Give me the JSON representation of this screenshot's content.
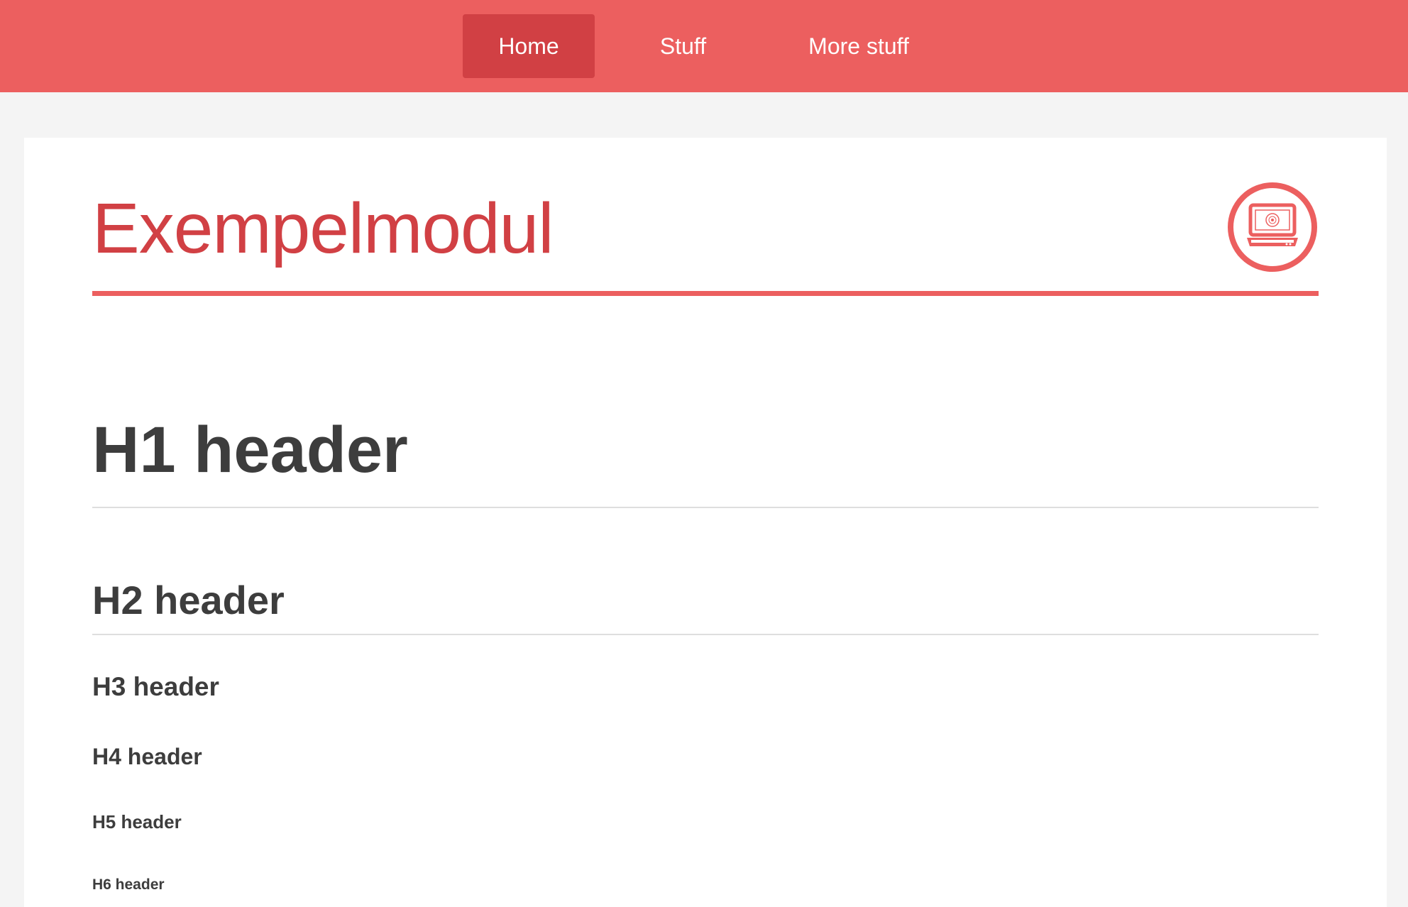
{
  "nav": {
    "items": [
      {
        "label": "Home",
        "active": true
      },
      {
        "label": "Stuff",
        "active": false
      },
      {
        "label": "More stuff",
        "active": false
      }
    ]
  },
  "module": {
    "title": "Exempelmodul",
    "icon": "laptop-icon"
  },
  "content": {
    "h1": "H1 header",
    "h2": "H2 header",
    "h3": "H3 header",
    "h4": "H4 header",
    "h5": "H5 header",
    "h6": "H6 header"
  },
  "colors": {
    "accent": "#ec5f5f",
    "accent_dark": "#d14044",
    "text": "#3d3d3d",
    "background": "#f4f4f4"
  }
}
